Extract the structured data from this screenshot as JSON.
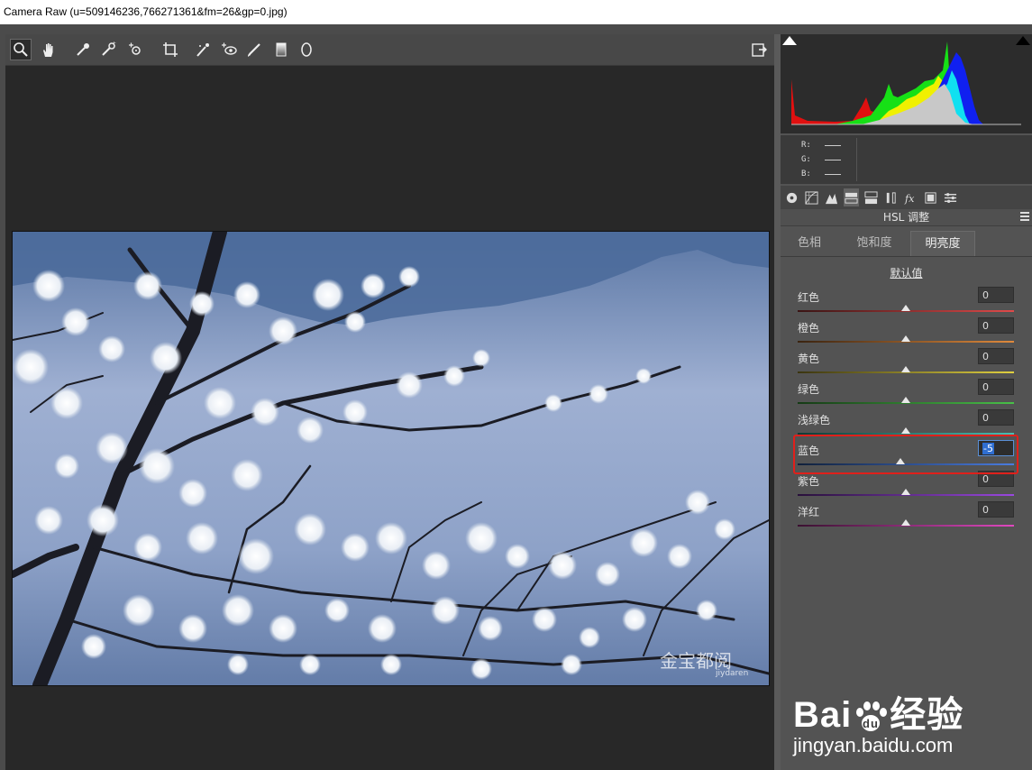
{
  "window": {
    "title": "Camera Raw (u=509146236,766271361&fm=26&gp=0.jpg)"
  },
  "toolbar": {
    "tools": [
      "zoom-icon",
      "hand-icon",
      "white-balance-icon",
      "color-sampler-icon",
      "targeted-adjustment-icon",
      "crop-icon",
      "spot-removal-icon",
      "red-eye-icon",
      "adjustment-brush-icon",
      "graduated-filter-icon",
      "radial-filter-icon"
    ],
    "right_tool": "open-preferences-icon"
  },
  "histogram": {
    "rgb_labels": [
      "R:",
      "G:",
      "B:"
    ]
  },
  "panel": {
    "title": "HSL 调整",
    "tabs": [
      "色相",
      "饱和度",
      "明亮度"
    ],
    "active_tab": "明亮度",
    "defaults_link": "默认值",
    "sliders": [
      {
        "label": "红色",
        "value": "0",
        "position": 0.5,
        "colors": [
          "#3a1414",
          "#e04a4a"
        ]
      },
      {
        "label": "橙色",
        "value": "0",
        "position": 0.5,
        "colors": [
          "#3a2310",
          "#e08a3c"
        ]
      },
      {
        "label": "黄色",
        "value": "0",
        "position": 0.5,
        "colors": [
          "#3a3410",
          "#e0d040"
        ]
      },
      {
        "label": "绿色",
        "value": "0",
        "position": 0.5,
        "colors": [
          "#153a15",
          "#48c048"
        ]
      },
      {
        "label": "浅绿色",
        "value": "0",
        "position": 0.5,
        "colors": [
          "#103a34",
          "#48c0b4"
        ]
      },
      {
        "label": "蓝色",
        "value": "-5",
        "position": 0.475,
        "colors": [
          "#10203a",
          "#4a7ce0"
        ]
      },
      {
        "label": "紫色",
        "value": "0",
        "position": 0.5,
        "colors": [
          "#28103a",
          "#9a48e0"
        ]
      },
      {
        "label": "洋红",
        "value": "0",
        "position": 0.5,
        "colors": [
          "#3a1030",
          "#e048c0"
        ]
      }
    ]
  },
  "photo": {
    "watermark": "金宝都阅",
    "watermark_sub": "jiydaren"
  },
  "baidu": {
    "logo_left": "Bai",
    "logo_right": "经验",
    "url": "jingyan.baidu.com"
  }
}
